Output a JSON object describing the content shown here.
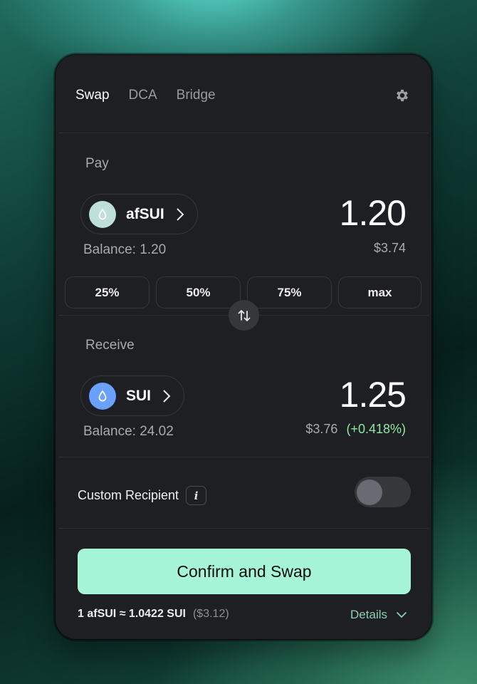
{
  "tabs": [
    {
      "label": "Swap",
      "active": true
    },
    {
      "label": "DCA",
      "active": false
    },
    {
      "label": "Bridge",
      "active": false
    }
  ],
  "settings_icon": "gear-icon",
  "pay": {
    "label": "Pay",
    "token": "afSUI",
    "token_icon": "droplet-icon",
    "token_icon_color": "#bfe0da",
    "balance_label": "Balance:",
    "balance_value": "1.20",
    "amount": "1.20",
    "usd": "$3.74"
  },
  "percent_buttons": [
    "25%",
    "50%",
    "75%",
    "max"
  ],
  "swap_direction_icon": "swap-arrows-icon",
  "receive": {
    "label": "Receive",
    "token": "SUI",
    "token_icon": "droplet-icon",
    "token_icon_color": "#6aa1ff",
    "balance_label": "Balance:",
    "balance_value": "24.02",
    "amount": "1.25",
    "usd": "$3.76",
    "delta": "(+0.418%)"
  },
  "recipient": {
    "label": "Custom Recipient",
    "info": "i",
    "toggle_on": false
  },
  "confirm_label": "Confirm and Swap",
  "rate": {
    "text": "1 afSUI ≈ 1.0422 SUI",
    "usd": "($3.12)"
  },
  "details_label": "Details",
  "colors": {
    "accent": "#a6f5d7",
    "positive": "#8fe7a4",
    "card": "#1e1f22"
  }
}
